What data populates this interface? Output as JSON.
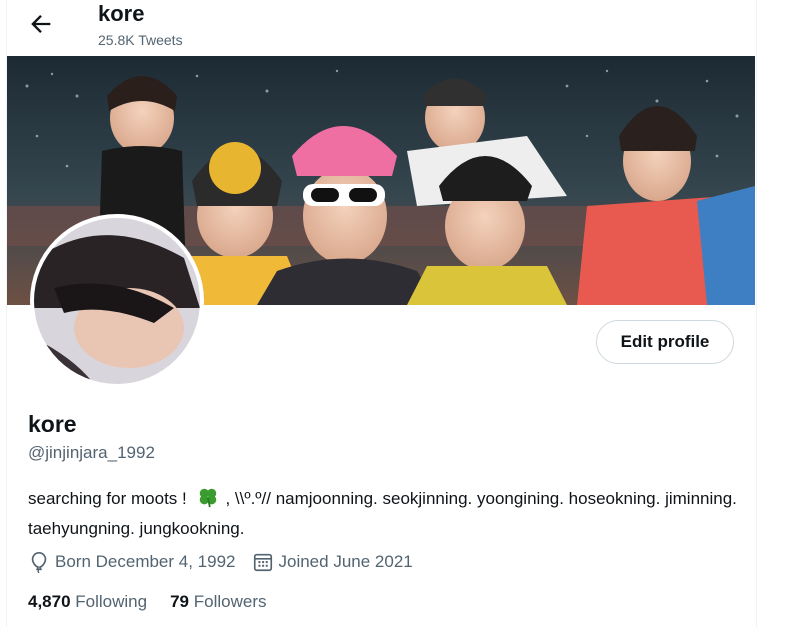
{
  "header": {
    "title": "kore",
    "tweet_count": "25.8K Tweets"
  },
  "profile": {
    "display_name": "kore",
    "handle": "@jinjinjara_1992",
    "bio_before_emoji": "searching for moots !",
    "bio_after_emoji": ", \\\\º.º// namjoonning. seokjinning. yoongining. hoseokning. jiminning. taehyungning. jungkookning.",
    "birthday": "Born December 4, 1992",
    "joined": "Joined June 2021",
    "following_count": "4,870",
    "following_label": "Following",
    "followers_count": "79",
    "followers_label": "Followers",
    "edit_button": "Edit profile"
  },
  "icons": {
    "back": "arrow-left-icon",
    "birthday": "balloon-icon",
    "joined": "calendar-icon",
    "emoji": "four-leaf-clover-icon"
  },
  "colors": {
    "text_primary": "#0f1419",
    "text_secondary": "#536471",
    "border": "#cfd9de",
    "clover_green": "#3a9b2f"
  }
}
